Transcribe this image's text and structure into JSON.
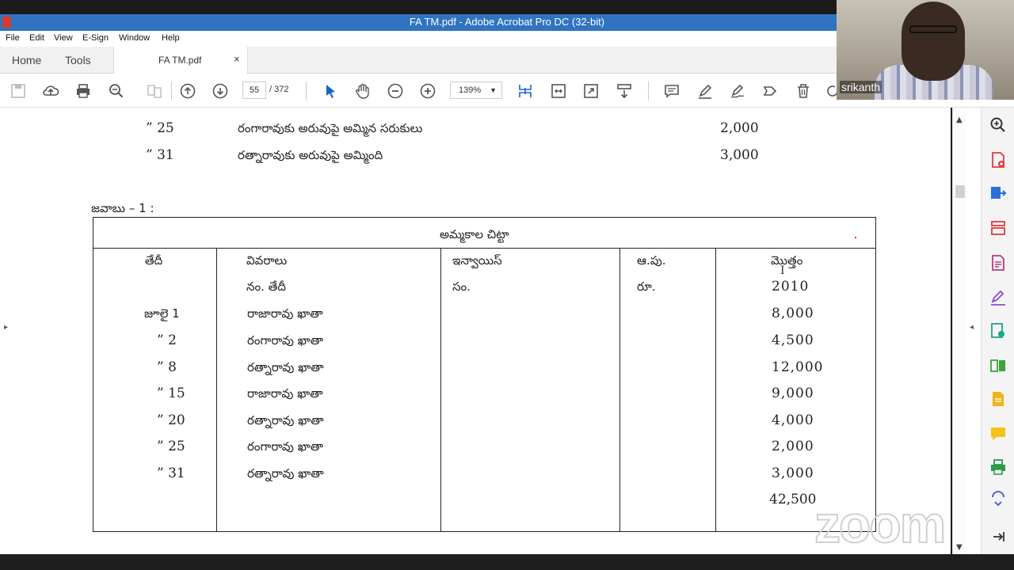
{
  "window": {
    "title": "FA TM.pdf - Adobe Acrobat Pro DC (32-bit)"
  },
  "menu": [
    "File",
    "Edit",
    "View",
    "E-Sign",
    "Window",
    "Help"
  ],
  "tabs": {
    "home": "Home",
    "tools": "Tools",
    "document": "FA TM.pdf",
    "close": "×"
  },
  "toolbar": {
    "page_current": "55",
    "page_total": "/  372",
    "zoom": "139%"
  },
  "video": {
    "participant_name": "srikanth"
  },
  "watermark": "zoom",
  "document": {
    "top_rows": [
      {
        "date": "” 25",
        "detail": "రంగారావుకు అరువుపై అమ్మిన సరుకులు",
        "amount": "2,000"
      },
      {
        "date": "” 31",
        "detail": "రత్నారావుకు అరువుపై అమ్మింది",
        "amount": "3,000"
      }
    ],
    "answer_label": "జవాబు – 1 :",
    "table": {
      "title": "అమ్మకాల చిట్టా",
      "headers": {
        "date": "తేదీ",
        "details": "వివరాలు",
        "details_sub": "నం.  తేదీ",
        "invoice": "ఇన్వాయిస్",
        "invoice_sub": "సం.",
        "lf": "ఆ.పు.",
        "lf_sub": "రూ.",
        "total": "మొత్తం",
        "total_sub": "2010"
      },
      "rows": [
        {
          "date": "జూలై 1",
          "detail": "రాజారావు ఖాతా",
          "amount": "8,000"
        },
        {
          "date": "” 2",
          "detail": "రంగారావు ఖాతా",
          "amount": "4,500"
        },
        {
          "date": "” 8",
          "detail": "రత్నారావు ఖాతా",
          "amount": "12,000"
        },
        {
          "date": "” 15",
          "detail": "రాజారావు ఖాతా",
          "amount": "9,000"
        },
        {
          "date": "” 20",
          "detail": "రత్నారావు ఖాతా",
          "amount": "4,000"
        },
        {
          "date": "” 25",
          "detail": "రంగారావు ఖాతా",
          "amount": "2,000"
        },
        {
          "date": "” 31",
          "detail": "రత్నారావు ఖాతా",
          "amount": "3,000"
        }
      ],
      "grand_total": "42,500"
    }
  }
}
